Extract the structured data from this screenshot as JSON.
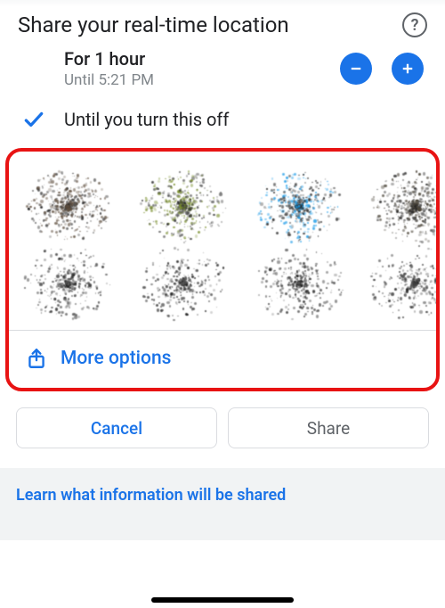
{
  "header": {
    "title": "Share your real-time location",
    "help_icon": "help-circle-icon"
  },
  "duration_option": {
    "selected": false,
    "primary": "For 1 hour",
    "secondary": "Until 5:21 PM",
    "minus_icon": "minus-icon",
    "plus_icon": "plus-icon"
  },
  "toggle_option": {
    "selected": true,
    "label": "Until you turn this off",
    "check_icon": "check-icon"
  },
  "contacts": {
    "items": [
      {
        "avatar_tint": "#5b4a3a"
      },
      {
        "avatar_tint": "#7a8f2e"
      },
      {
        "avatar_tint": "#1a9be8"
      },
      {
        "avatar_tint": "#4a4438"
      }
    ]
  },
  "more_options": {
    "icon": "share-up-icon",
    "label": "More options"
  },
  "buttons": {
    "cancel": "Cancel",
    "share": "Share"
  },
  "footer": {
    "link": "Learn what information will be shared"
  },
  "colors": {
    "accent": "#1a73e8",
    "highlight_border": "#e81313"
  }
}
